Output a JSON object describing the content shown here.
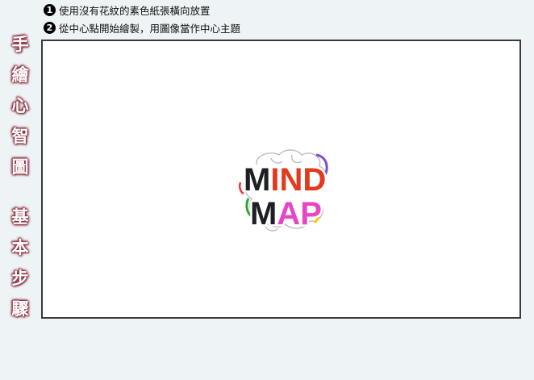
{
  "steps": [
    {
      "num": "1",
      "text": "使用沒有花紋的素色紙張橫向放置"
    },
    {
      "num": "2",
      "text": "從中心點開始繪製，用圖像當作中心主題"
    }
  ],
  "side_title": {
    "chars": [
      "手",
      "繪",
      "心",
      "智",
      "圖",
      "基",
      "本",
      "步",
      "驟"
    ]
  },
  "logo": {
    "line1": [
      "M",
      "IND"
    ],
    "line2": [
      "M",
      "AP"
    ]
  },
  "colors": {
    "background": "#eef4f6",
    "dark": "#1d1f24",
    "red": "#e23a1e",
    "magenta": "#e844c8"
  }
}
